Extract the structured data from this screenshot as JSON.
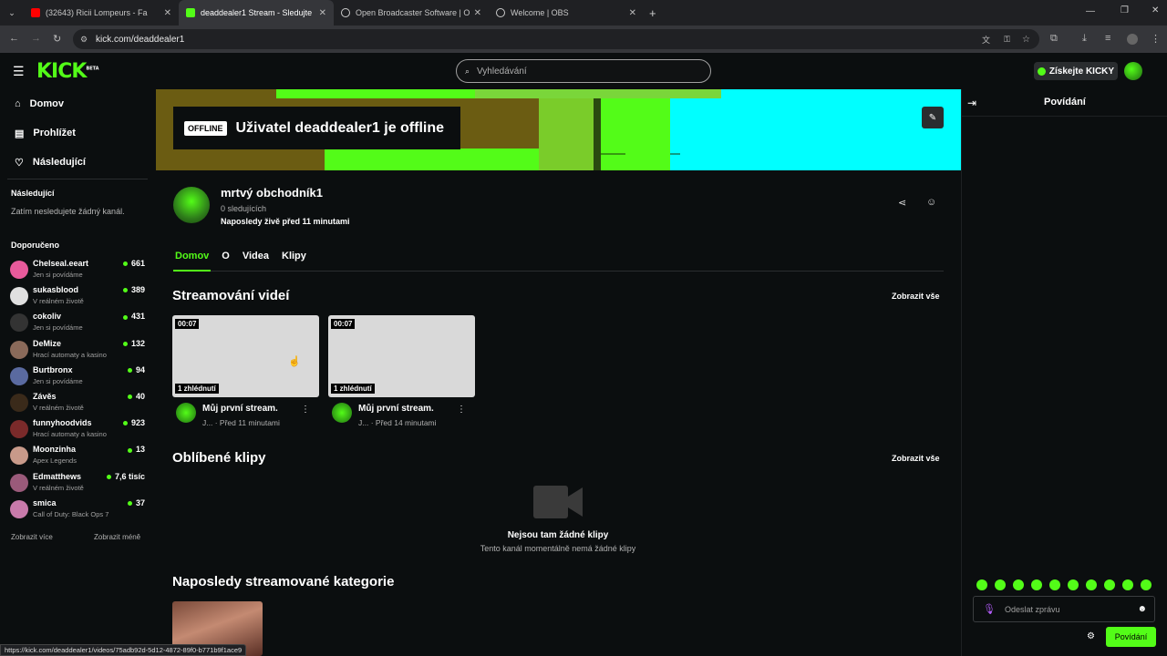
{
  "browser": {
    "tabs": [
      {
        "label": "(32643) Ricii Lompeurs - Fa",
        "active": false,
        "fav_color": "#ff0000"
      },
      {
        "label": "deaddealer1 Stream - Sledujte",
        "active": true,
        "fav_color": "#53fc18"
      },
      {
        "label": "Open Broadcaster Software | O",
        "active": false,
        "fav_color": "#cccccc"
      },
      {
        "label": "Welcome | OBS",
        "active": false,
        "fav_color": "#cccccc"
      }
    ],
    "url": "kick.com/deaddealer1",
    "status_url": "https://kick.com/deaddealer1/videos/75adb92d-5d12-4872-89f0-b771b9f1ace9"
  },
  "header": {
    "logo": "KICK",
    "logo_badge": "BETA",
    "search_placeholder": "Vyhledávání",
    "get_kicky": "Získejte KICKY"
  },
  "sidebar": {
    "nav": [
      {
        "label": "Domov",
        "icon": "home-icon"
      },
      {
        "label": "Prohlížet",
        "icon": "browse-icon"
      },
      {
        "label": "Následující",
        "icon": "heart-icon"
      }
    ],
    "following_heading": "Následující",
    "following_empty": "Zatím nesledujete žádný kanál.",
    "recommended_heading": "Doporučeno",
    "recommended": [
      {
        "name": "Chelseal.eeart",
        "category": "Jen si povídáme",
        "viewers": "661",
        "color": "#e85a9b"
      },
      {
        "name": "sukasblood",
        "category": "V reálném životě",
        "viewers": "389",
        "color": "#e0e0e0"
      },
      {
        "name": "cokoliv",
        "category": "Jen si povídáme",
        "viewers": "431",
        "color": "#333333"
      },
      {
        "name": "DeMize",
        "category": "Hrací automaty a kasino",
        "viewers": "132",
        "color": "#8a6a5a"
      },
      {
        "name": "Burtbronx",
        "category": "Jen si povídáme",
        "viewers": "94",
        "color": "#5a6aa0"
      },
      {
        "name": "Závěs",
        "category": "V reálném životě",
        "viewers": "40",
        "color": "#3a2a1a"
      },
      {
        "name": "funnyhoodvids",
        "category": "Hrací automaty a kasino",
        "viewers": "923",
        "color": "#7a2a2a"
      },
      {
        "name": "Moonzinha",
        "category": "Apex Legends",
        "viewers": "13",
        "color": "#c89a8a"
      },
      {
        "name": "Edmatthews",
        "category": "V reálném životě",
        "viewers": "7,6 tisíc",
        "color": "#9a5a7a"
      },
      {
        "name": "smica",
        "category": "Call of Duty: Black Ops 7",
        "viewers": "37",
        "color": "#c87aaa"
      }
    ],
    "show_more": "Zobrazit více",
    "show_less": "Zobrazit méně"
  },
  "banner": {
    "offline_tag": "OFFLINE",
    "offline_text": "Uživatel deaddealer1 je offline"
  },
  "channel": {
    "name": "mrtvý obchodník1",
    "followers": "0 sledujících",
    "last_live": "Naposledy živě před 11 minutami",
    "tabs": [
      "Domov",
      "O",
      "Videa",
      "Klipy"
    ]
  },
  "sections": {
    "streams_title": "Streamování videí",
    "view_all": "Zobrazit vše",
    "clips_title": "Oblíbené klipy",
    "no_clips_title": "Nejsou tam žádné klipy",
    "no_clips_sub": "Tento kanál momentálně nemá žádné klipy",
    "categories_title": "Naposledy streamované kategorie"
  },
  "videos": [
    {
      "duration": "00:07",
      "views": "1 zhlédnutí",
      "title": "Můj první stream.",
      "author": "J...",
      "age": "Před 11 minutami"
    },
    {
      "duration": "00:07",
      "views": "1 zhlédnutí",
      "title": "Můj první stream.",
      "author": "J...",
      "age": "Před 14 minutami"
    }
  ],
  "chat": {
    "title": "Povídání",
    "input_placeholder": "Odeslat zprávu",
    "send_label": "Povídání"
  }
}
